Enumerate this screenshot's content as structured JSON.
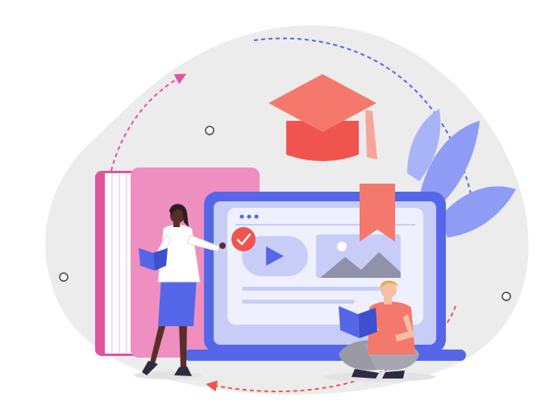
{
  "illustration": {
    "subject": "online learning",
    "colors": {
      "blob": "#ececec",
      "book_pink": "#ee8fc0",
      "book_magenta": "#e0559f",
      "laptop_frame": "#5567e8",
      "laptop_screen": "#c8cdf8",
      "content_card": "#eef0fd",
      "accent_red": "#f0544f",
      "coral": "#f4786b",
      "leaves": "#8e9cf5",
      "arrow_pink": "#e0559f",
      "arrow_blue": "#5567e8",
      "arrow_red": "#f0544f"
    },
    "icons": [
      "graduation-cap-icon",
      "play-icon",
      "image-icon",
      "check-icon",
      "bookmark-icon",
      "book-icon"
    ]
  }
}
